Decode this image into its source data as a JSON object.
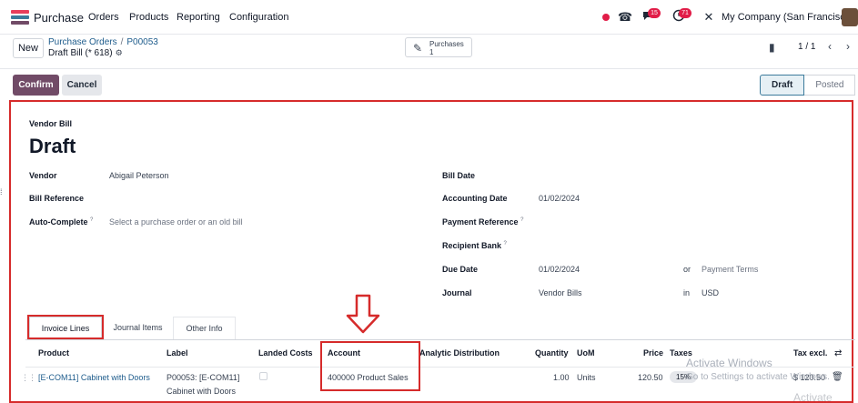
{
  "navbar": {
    "app_name": "Purchase",
    "menu": [
      "Orders",
      "Products",
      "Reporting",
      "Configuration"
    ],
    "chat_badge": "15",
    "activity_badge": "71",
    "company": "My Company (San Francisco)"
  },
  "control": {
    "new_label": "New",
    "breadcrumb_parent": "Purchase Orders",
    "breadcrumb_child": "P00053",
    "breadcrumb_sep": "/",
    "record_name": "Draft Bill (* 618)",
    "smart_button_label": "Purchases",
    "smart_button_count": "1",
    "pager": "1 / 1"
  },
  "actions": {
    "confirm": "Confirm",
    "cancel": "Cancel"
  },
  "status": {
    "stages": [
      "Draft",
      "Posted"
    ],
    "active": "Draft"
  },
  "form": {
    "type_label": "Vendor Bill",
    "title": "Draft",
    "vendor_label": "Vendor",
    "vendor_value": "Abigail Peterson",
    "bill_reference_label": "Bill Reference",
    "auto_complete_label": "Auto-Complete",
    "auto_complete_placeholder": "Select a purchase order or an old bill",
    "bill_date_label": "Bill Date",
    "accounting_date_label": "Accounting Date",
    "accounting_date_value": "01/02/2024",
    "payment_reference_label": "Payment Reference",
    "recipient_bank_label": "Recipient Bank",
    "due_date_label": "Due Date",
    "due_date_value": "01/02/2024",
    "or_label": "or",
    "payment_terms_placeholder": "Payment Terms",
    "journal_label": "Journal",
    "journal_value": "Vendor Bills",
    "in_label": "in",
    "currency_value": "USD",
    "help_mark": "?"
  },
  "tabs": [
    "Invoice Lines",
    "Journal Items",
    "Other Info"
  ],
  "lines": {
    "headers": {
      "product": "Product",
      "label": "Label",
      "landed_costs": "Landed Costs",
      "account": "Account",
      "analytic": "Analytic Distribution",
      "quantity": "Quantity",
      "uom": "UoM",
      "price": "Price",
      "taxes": "Taxes",
      "tax_excl": "Tax excl."
    },
    "rows": [
      {
        "product": "[E-COM11] Cabinet with Doors",
        "label_line1": "P00053: [E-COM11]",
        "label_line2": "Cabinet with Doors",
        "account": "400000 Product Sales",
        "quantity": "1.00",
        "uom": "Units",
        "price": "120.50",
        "tax": "15%",
        "subtotal": "$ 120.50"
      }
    ]
  },
  "watermark": {
    "line1": "Activate Windows",
    "line2": "Go to Settings to activate Windows.",
    "corner": "Activate"
  },
  "colors": {
    "brand": "#714b67",
    "annotation_red": "#d62b2b",
    "link": "#1e5c8c"
  }
}
